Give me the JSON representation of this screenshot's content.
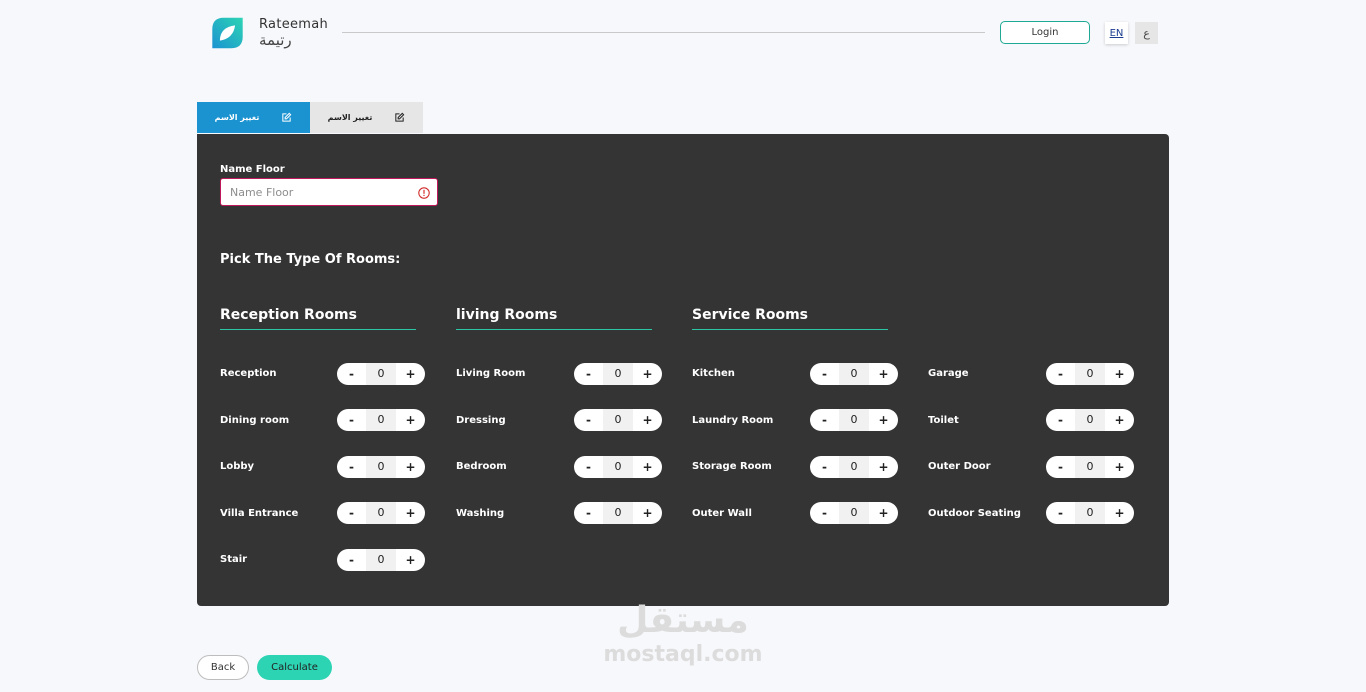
{
  "header": {
    "logo_en": "Rateemah",
    "logo_ar": "رتيمة",
    "login_label": "Login",
    "lang_en": "EN",
    "lang_ar": "ع"
  },
  "tabs": [
    {
      "label": "تغيير الاسم",
      "active": true
    },
    {
      "label": "تغيير الاسم",
      "active": false
    }
  ],
  "form": {
    "name_label": "Name Floor",
    "name_placeholder": "Name Floor",
    "name_value": "",
    "pick_title": "Pick The Type Of Rooms:"
  },
  "categories": [
    {
      "title": "Reception Rooms"
    },
    {
      "title": "living Rooms"
    },
    {
      "title": "Service Rooms"
    }
  ],
  "rooms": {
    "reception": [
      {
        "label": "Reception",
        "count": "0"
      },
      {
        "label": "Dining room",
        "count": "0"
      },
      {
        "label": "Lobby",
        "count": "0"
      },
      {
        "label": "Villa Entrance",
        "count": "0"
      },
      {
        "label": "Stair",
        "count": "0"
      }
    ],
    "living": [
      {
        "label": "Living Room",
        "count": "0"
      },
      {
        "label": "Dressing",
        "count": "0"
      },
      {
        "label": "Bedroom",
        "count": "0"
      },
      {
        "label": "Washing",
        "count": "0"
      }
    ],
    "service_a": [
      {
        "label": "Kitchen",
        "count": "0"
      },
      {
        "label": "Laundry Room",
        "count": "0"
      },
      {
        "label": "Storage Room",
        "count": "0"
      },
      {
        "label": "Outer Wall",
        "count": "0"
      }
    ],
    "service_b": [
      {
        "label": "Garage",
        "count": "0"
      },
      {
        "label": "Toilet",
        "count": "0"
      },
      {
        "label": "Outer Door",
        "count": "0"
      },
      {
        "label": "Outdoor Seating",
        "count": "0"
      }
    ]
  },
  "stepper": {
    "minus": "-",
    "plus": "+"
  },
  "footer": {
    "back_label": "Back",
    "calculate_label": "Calculate"
  },
  "watermark": {
    "ar": "مستقل",
    "en": "mostaql.com"
  },
  "colors": {
    "accent": "#2dd4b4",
    "tab_active": "#1b93d1",
    "panel": "#343434",
    "error_border": "#c2185b"
  }
}
